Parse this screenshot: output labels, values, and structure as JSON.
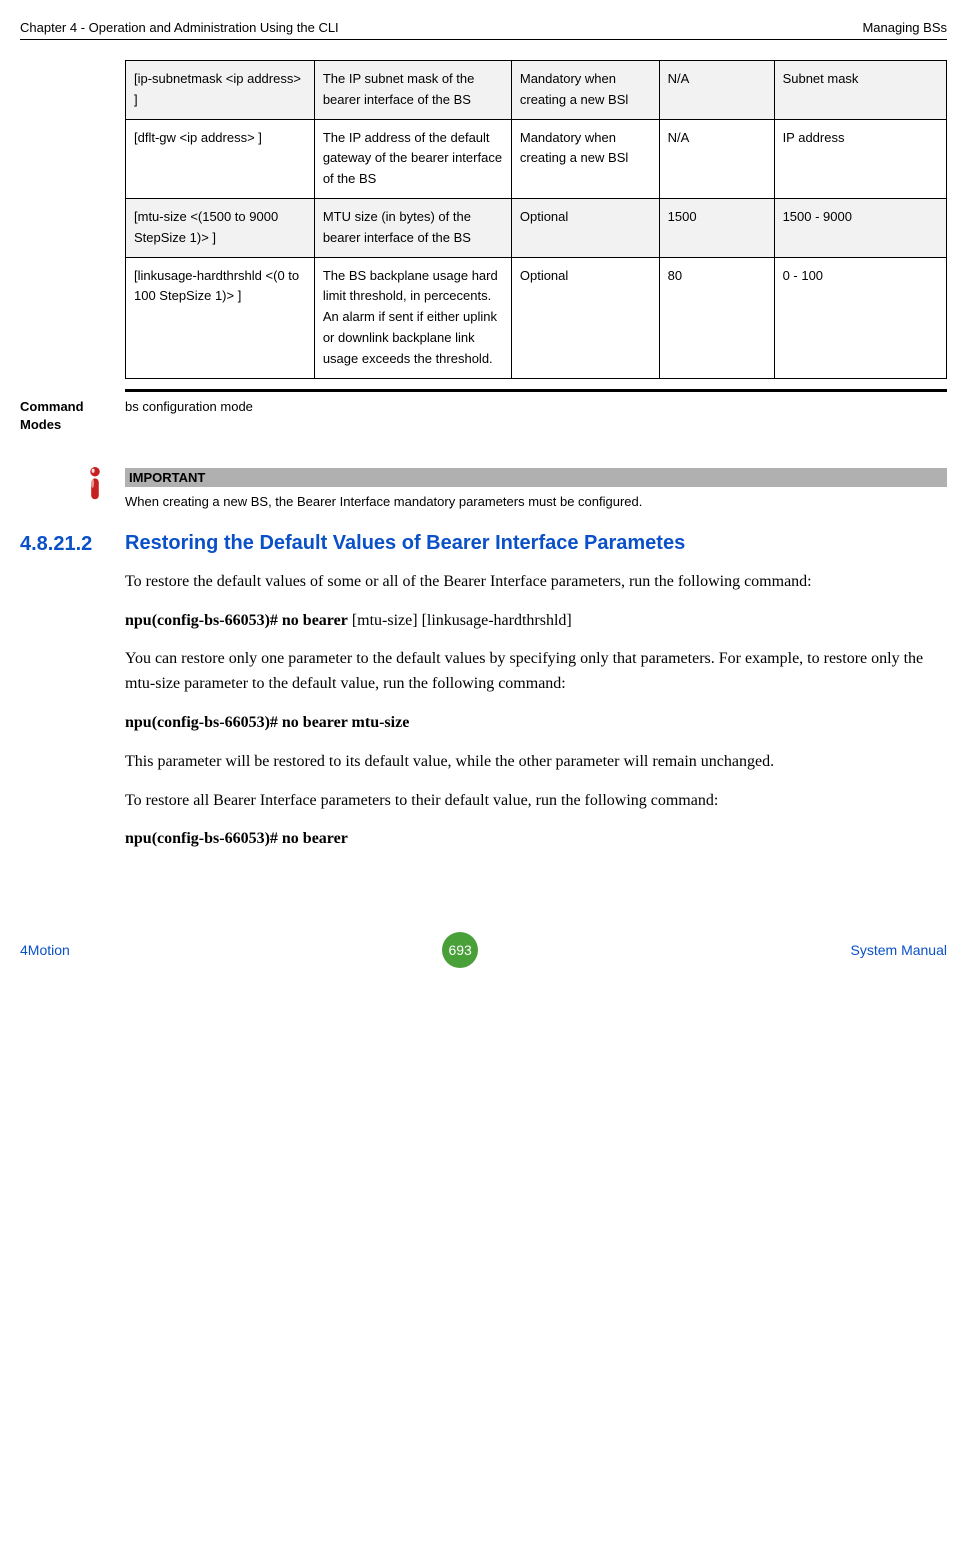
{
  "header": {
    "left": "Chapter 4 - Operation and Administration Using the CLI",
    "right": "Managing BSs"
  },
  "table": {
    "rows": [
      {
        "c1": "[ip-subnetmask <ip address> ]",
        "c2": "The IP subnet mask of the bearer interface of the BS",
        "c3": "Mandatory when creating a new BSl",
        "c4": "N/A",
        "c5": "Subnet mask"
      },
      {
        "c1": "[dflt-gw <ip address> ]",
        "c2": "The IP address of the default gateway of the bearer interface of the BS",
        "c3": "Mandatory when creating a new BSl",
        "c4": "N/A",
        "c5": "IP address"
      },
      {
        "c1": "[mtu-size <(1500 to 9000 StepSize 1)> ]",
        "c2": "MTU size (in bytes) of the bearer interface of the BS",
        "c3": "Optional",
        "c4": "1500",
        "c5": "1500 - 9000"
      },
      {
        "c1": "[linkusage-hardthrshld <(0 to 100 StepSize 1)> ]",
        "c2": "The BS backplane usage hard limit threshold, in percecents. An alarm if sent if either uplink or downlink backplane link usage exceeds the threshold.",
        "c3": "Optional",
        "c4": "80",
        "c5": "0 - 100"
      }
    ]
  },
  "command_modes": {
    "label1": "Command",
    "label2": "Modes",
    "value": "bs configuration mode"
  },
  "important": {
    "heading": "IMPORTANT",
    "text": "When creating a new BS, the Bearer Interface  mandatory parameters must be configured."
  },
  "section": {
    "number": "4.8.21.2",
    "title": "Restoring the Default Values of Bearer Interface Parametes"
  },
  "paragraphs": {
    "p1": "To restore the default values of some or all of the Bearer Interface parameters, run the following command:",
    "p2_bold": "npu(config-bs-66053)# no bearer",
    "p2_rest": " [mtu-size] [linkusage-hardthrshld]",
    "p3": "You can restore only one parameter to the default values by specifying only that parameters. For example, to restore only the mtu-size parameter to the default value, run the following command:",
    "p4_bold": "npu(config-bs-66053)# no bearer mtu-size",
    "p5": "This parameter will be restored to its default value, while the other parameter will remain unchanged.",
    "p6": "To restore all Bearer Interface parameters to their default value, run the following command:",
    "p7_bold": "npu(config-bs-66053)# no bearer"
  },
  "footer": {
    "left": "4Motion",
    "page": "693",
    "right": "System Manual"
  }
}
